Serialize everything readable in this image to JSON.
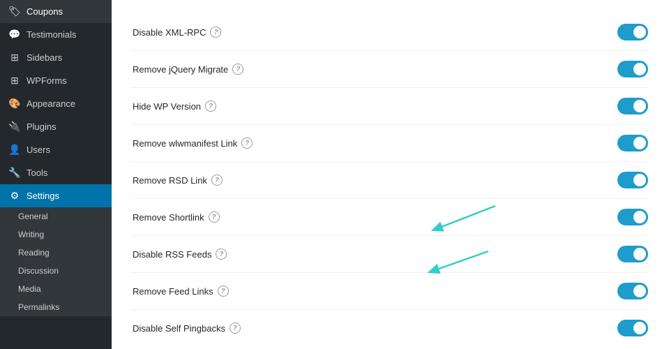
{
  "sidebar": {
    "items": [
      {
        "id": "coupons",
        "label": "Coupons",
        "icon": "🏷"
      },
      {
        "id": "testimonials",
        "label": "Testimonials",
        "icon": "💬"
      },
      {
        "id": "sidebars",
        "label": "Sidebars",
        "icon": "⊞"
      },
      {
        "id": "wpforms",
        "label": "WPForms",
        "icon": "⊞"
      },
      {
        "id": "appearance",
        "label": "Appearance",
        "icon": "🎨"
      },
      {
        "id": "plugins",
        "label": "Plugins",
        "icon": "🔌"
      },
      {
        "id": "users",
        "label": "Users",
        "icon": "👤"
      },
      {
        "id": "tools",
        "label": "Tools",
        "icon": "🔧"
      },
      {
        "id": "settings",
        "label": "Settings",
        "icon": "⚙",
        "active": true
      }
    ],
    "submenu": [
      {
        "id": "general",
        "label": "General"
      },
      {
        "id": "writing",
        "label": "Writing"
      },
      {
        "id": "reading",
        "label": "Reading"
      },
      {
        "id": "discussion",
        "label": "Discussion"
      },
      {
        "id": "media",
        "label": "Media"
      },
      {
        "id": "permalinks",
        "label": "Permalinks"
      }
    ]
  },
  "settings": [
    {
      "id": "disable-xml-rpc",
      "label": "Disable XML-RPC",
      "enabled": true
    },
    {
      "id": "remove-jquery-migrate",
      "label": "Remove jQuery Migrate",
      "enabled": true
    },
    {
      "id": "hide-wp-version",
      "label": "Hide WP Version",
      "enabled": true
    },
    {
      "id": "remove-wlwmanifest-link",
      "label": "Remove wlwmanifest Link",
      "enabled": true
    },
    {
      "id": "remove-rsd-link",
      "label": "Remove RSD Link",
      "enabled": true
    },
    {
      "id": "remove-shortlink",
      "label": "Remove Shortlink",
      "enabled": true
    },
    {
      "id": "disable-rss-feeds",
      "label": "Disable RSS Feeds",
      "enabled": true
    },
    {
      "id": "remove-feed-links",
      "label": "Remove Feed Links",
      "enabled": true
    },
    {
      "id": "disable-self-pingbacks",
      "label": "Disable Self Pingbacks",
      "enabled": true
    }
  ]
}
